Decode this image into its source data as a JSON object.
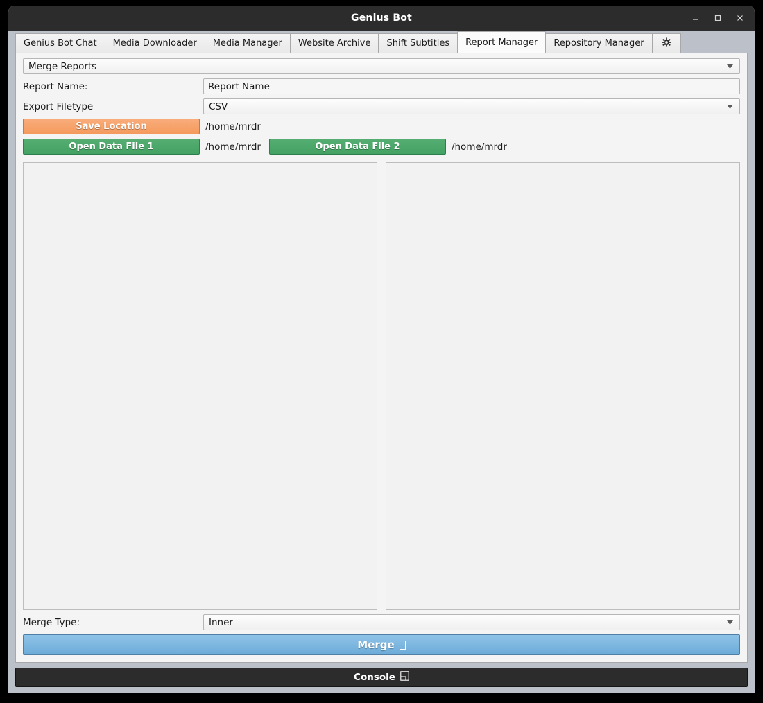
{
  "window": {
    "title": "Genius Bot",
    "controls": {
      "minimize": "minimize-icon",
      "maximize": "maximize-icon",
      "close": "close-icon"
    }
  },
  "tabs": [
    {
      "label": "Genius Bot Chat",
      "selected": false
    },
    {
      "label": "Media Downloader",
      "selected": false
    },
    {
      "label": "Media Manager",
      "selected": false
    },
    {
      "label": "Website Archive",
      "selected": false
    },
    {
      "label": "Shift Subtitles",
      "selected": false
    },
    {
      "label": "Report Manager",
      "selected": true
    },
    {
      "label": "Repository Manager",
      "selected": false
    },
    {
      "label": "",
      "selected": false,
      "icon": "gear-icon"
    }
  ],
  "report_manager": {
    "mode_select": {
      "value": "Merge Reports",
      "options": [
        "Merge Reports"
      ],
      "arrow_icon": "chevron-down-icon"
    },
    "report_name": {
      "label": "Report Name:",
      "value": "Report Name",
      "placeholder": "Report Name"
    },
    "export_filetype": {
      "label": "Export Filetype",
      "value": "CSV",
      "options": [
        "CSV"
      ],
      "arrow_icon": "chevron-down-icon"
    },
    "save_location": {
      "button_label": "Save Location",
      "path": "/home/mrdr",
      "color": "#f49a5d"
    },
    "data_file_1": {
      "button_label": "Open Data File 1",
      "path": "/home/mrdr",
      "color": "#43a263"
    },
    "data_file_2": {
      "button_label": "Open Data File 2",
      "path": "/home/mrdr",
      "color": "#43a263"
    },
    "preview_pane_1": {
      "rows": []
    },
    "preview_pane_2": {
      "rows": []
    },
    "merge_type": {
      "label": "Merge Type:",
      "value": "Inner",
      "options": [
        "Inner"
      ],
      "arrow_icon": "chevron-down-icon"
    },
    "merge_button": {
      "label": "Merge",
      "glyph": "missing-glyph-box",
      "color": "#6cabd8"
    }
  },
  "console": {
    "label": "Console",
    "glyph": "terminal-window-icon"
  }
}
